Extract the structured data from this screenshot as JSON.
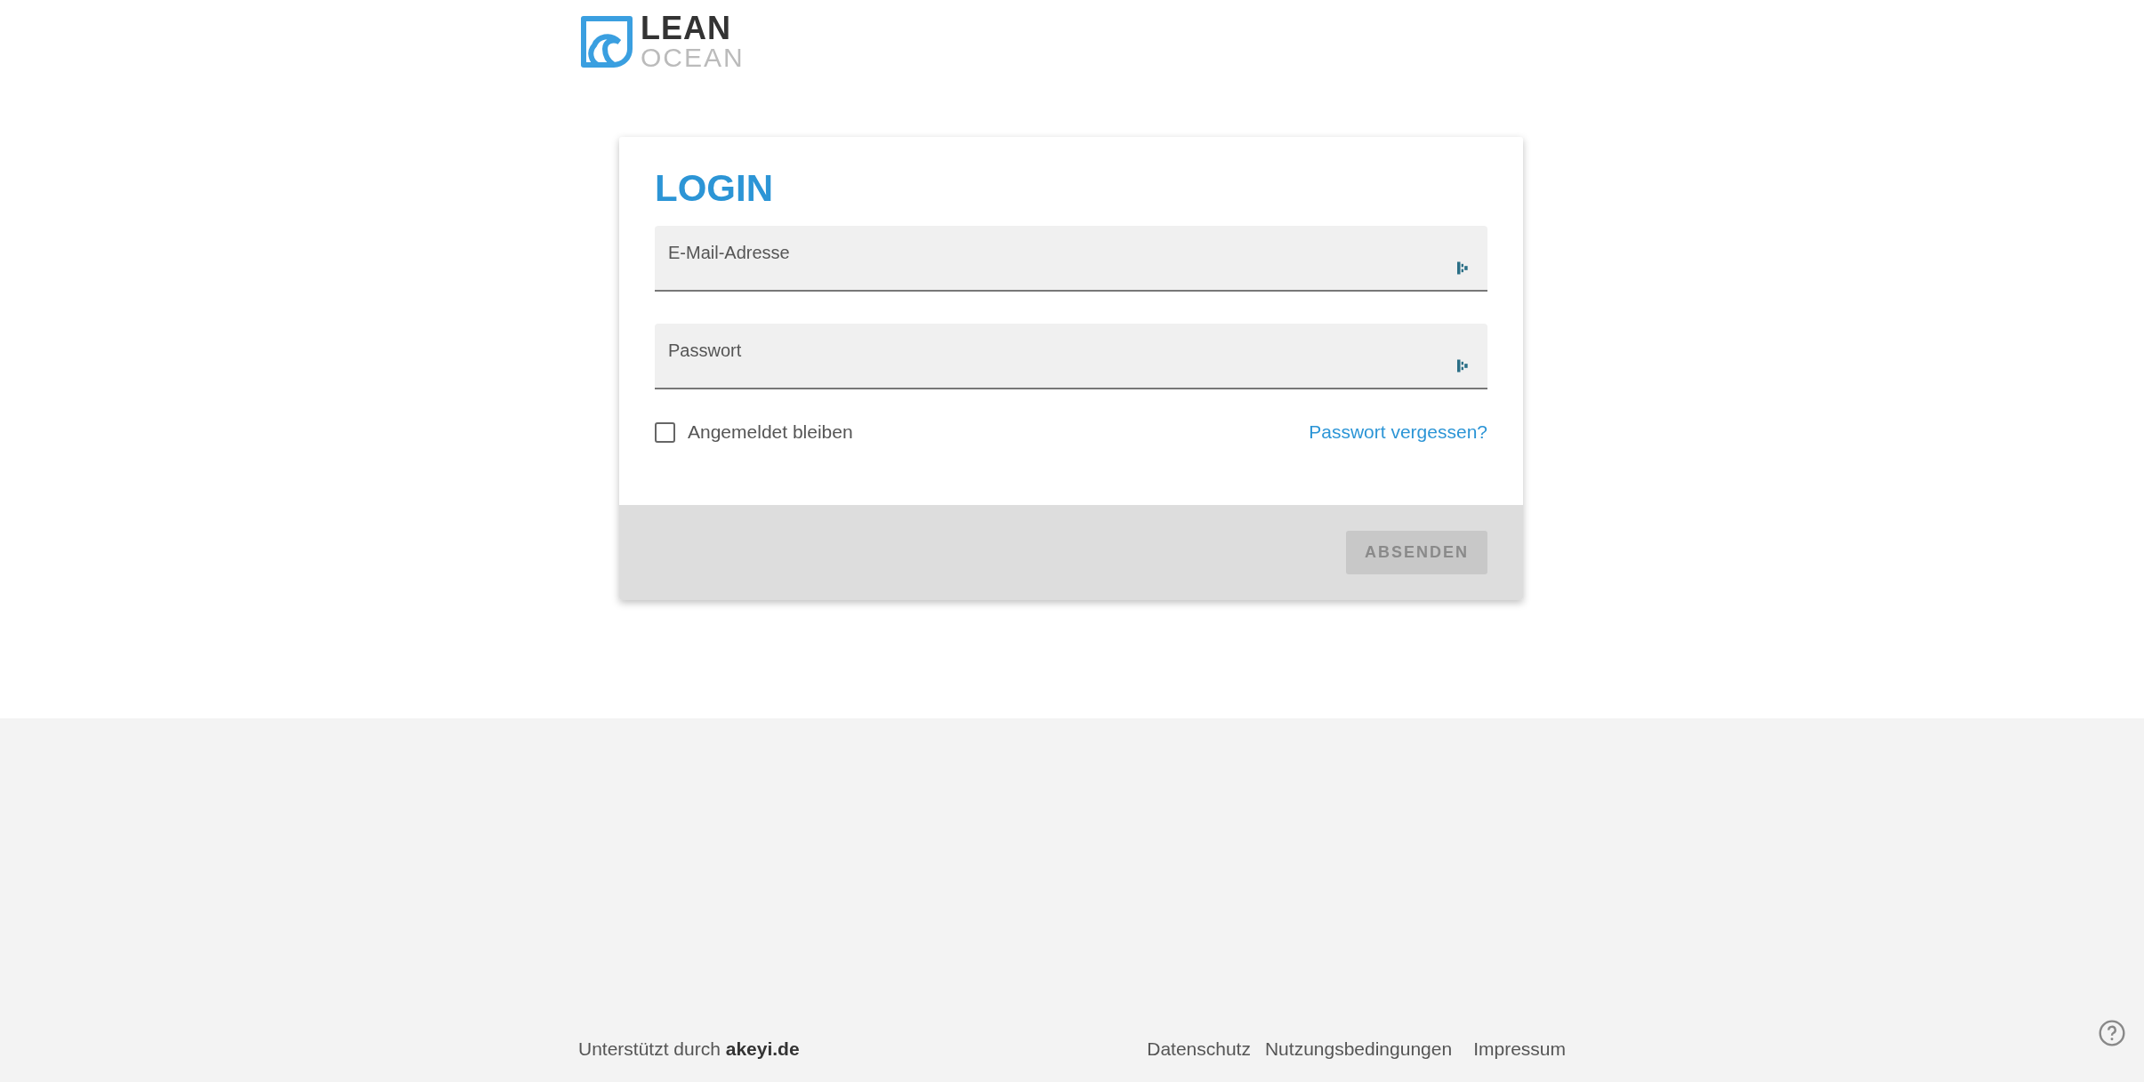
{
  "logo": {
    "line_1": "LEAN",
    "line_2": "OCEAN"
  },
  "login": {
    "title": "LOGIN",
    "fields": [
      {
        "placeholder": "E-Mail-Adresse"
      },
      {
        "placeholder": "Passwort"
      }
    ],
    "remember": {
      "label": "Angemeldet bleiben",
      "checked": false
    },
    "forgot_link": "Passwort vergessen?",
    "submit": {
      "label": "ABSENDEN",
      "disabled": true
    }
  },
  "footer": {
    "powered_by": "Unterstützt durch **akeyi.de**",
    "links": [
      "Datenschutz",
      "Nutzungsbedingungen",
      "Impressum"
    ]
  }
}
